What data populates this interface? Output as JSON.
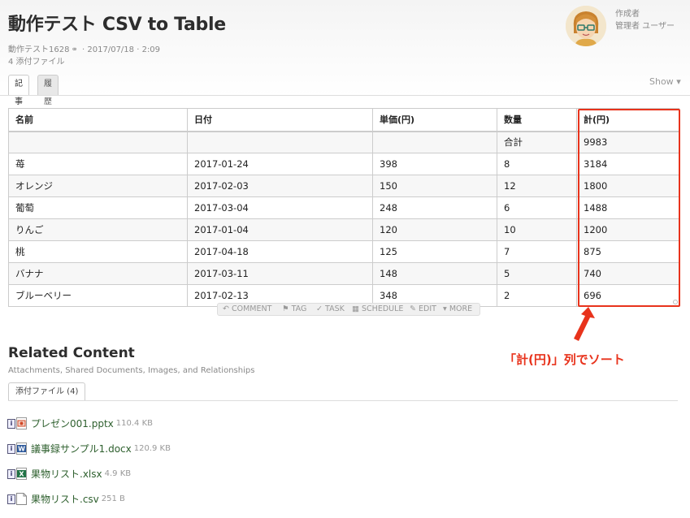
{
  "header": {
    "title": "動作テスト CSV to Table",
    "meta_prefix": "動作テスト1628",
    "meta_date": "2017/07/18",
    "meta_time": "2:09",
    "attachments": "4 添付ファイル",
    "author_role": "作成者",
    "author_name": "管理者 ユーザー"
  },
  "tabs": {
    "article": "記事",
    "history": "履歴",
    "show": "Show"
  },
  "table": {
    "columns": [
      "名前",
      "日付",
      "単価(円)",
      "数量",
      "計(円)"
    ],
    "rows": [
      [
        "",
        "",
        "",
        "合計",
        "9983"
      ],
      [
        "苺",
        "2017-01-24",
        "398",
        "8",
        "3184"
      ],
      [
        "オレンジ",
        "2017-02-03",
        "150",
        "12",
        "1800"
      ],
      [
        "葡萄",
        "2017-03-04",
        "248",
        "6",
        "1488"
      ],
      [
        "りんご",
        "2017-01-04",
        "120",
        "10",
        "1200"
      ],
      [
        "桃",
        "2017-04-18",
        "125",
        "7",
        "875"
      ],
      [
        "バナナ",
        "2017-03-11",
        "148",
        "5",
        "740"
      ],
      [
        "ブルーベリー",
        "2017-02-13",
        "348",
        "2",
        "696"
      ]
    ]
  },
  "actions": {
    "comment": "COMMENT",
    "tag": "TAG",
    "task": "TASK",
    "schedule": "SCHEDULE",
    "edit": "EDIT",
    "more": "MORE"
  },
  "annotation": "「計(円)」列でソート",
  "related": {
    "title": "Related Content",
    "subtitle": "Attachments, Shared Documents, Images, and Relationships",
    "tab": "添付ファイル (4)",
    "files": [
      {
        "name": "プレゼン001.pptx",
        "size": "110.4 KB",
        "icon": "pptx-file-icon"
      },
      {
        "name": "議事録サンプル1.docx",
        "size": "120.9 KB",
        "icon": "docx-file-icon"
      },
      {
        "name": "果物リスト.xlsx",
        "size": "4.9 KB",
        "icon": "xlsx-file-icon"
      },
      {
        "name": "果物リスト.csv",
        "size": "251 B",
        "icon": "csv-file-icon"
      }
    ]
  },
  "colors": {
    "highlight": "#e8331c",
    "link": "#2d5f2d"
  }
}
